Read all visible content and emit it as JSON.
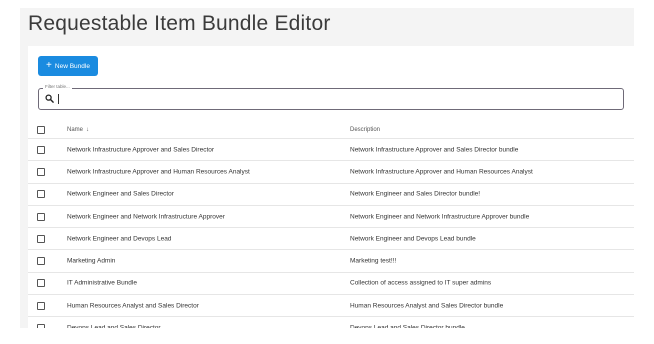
{
  "page": {
    "title": "Requestable Item Bundle Editor"
  },
  "toolbar": {
    "new_bundle_label": "New Bundle",
    "new_bundle_icon": "plus-icon"
  },
  "filter": {
    "legend": "Filter table...",
    "value": ""
  },
  "table": {
    "columns": {
      "name": "Name",
      "name_sort": "↓",
      "description": "Description"
    },
    "rows": [
      {
        "name": "Network Infrastructure Approver and Sales Director",
        "description": "Network Infrastructure Approver and Sales Director bundle"
      },
      {
        "name": "Network Infrastructure Approver and Human Resources Analyst",
        "description": "Network Infrastructure Approver and Human Resources Analyst"
      },
      {
        "name": "Network Engineer and Sales Director",
        "description": "Network Engineer and Sales Director bundle!"
      },
      {
        "name": "Network Engineer and Network Infrastructure Approver",
        "description": "Network Engineer and Network Infrastructure Approver bundle"
      },
      {
        "name": "Network Engineer and Devops Lead",
        "description": "Network Engineer and Devops Lead bundle"
      },
      {
        "name": "Marketing Admin",
        "description": "Marketing test!!!"
      },
      {
        "name": "IT Administrative Bundle",
        "description": "Collection of access assigned to IT super admins"
      },
      {
        "name": "Human Resources Analyst and Sales Director",
        "description": "Human Resources Analyst and Sales Director bundle"
      },
      {
        "name": "Devops Lead and Sales Director",
        "description": "Devops Lead and Sales Director bundle"
      }
    ]
  },
  "colors": {
    "accent": "#1a8be0",
    "background": "#f4f4f4",
    "filter_border": "#6f6a78"
  }
}
